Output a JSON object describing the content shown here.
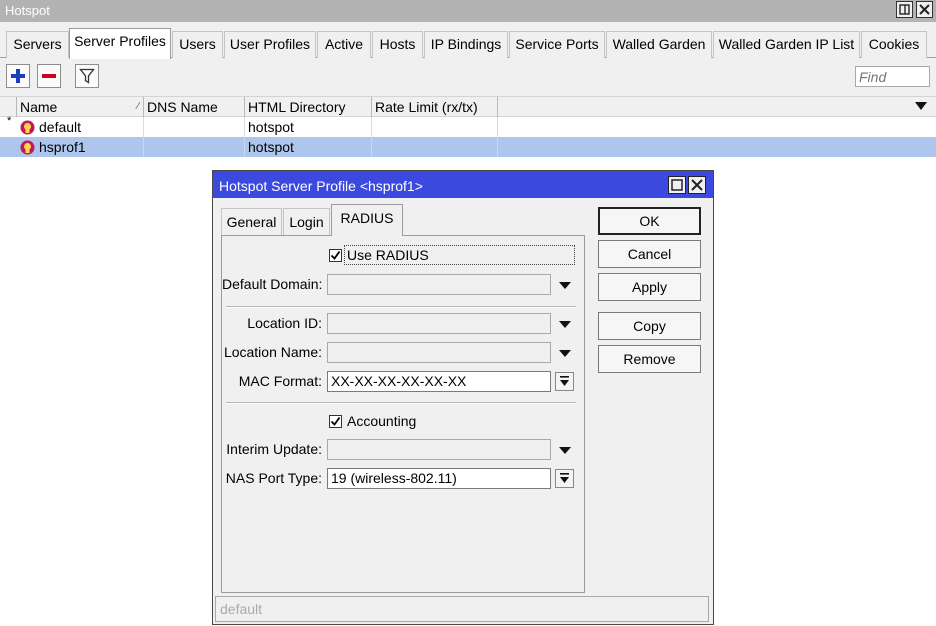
{
  "window": {
    "title": "Hotspot"
  },
  "tabs": [
    {
      "label": "Servers"
    },
    {
      "label": "Server Profiles"
    },
    {
      "label": "Users"
    },
    {
      "label": "User Profiles"
    },
    {
      "label": "Active"
    },
    {
      "label": "Hosts"
    },
    {
      "label": "IP Bindings"
    },
    {
      "label": "Service Ports"
    },
    {
      "label": "Walled Garden"
    },
    {
      "label": "Walled Garden IP List"
    },
    {
      "label": "Cookies"
    }
  ],
  "toolbar": {
    "find_placeholder": "Find"
  },
  "table": {
    "columns": [
      "Name",
      "DNS Name",
      "HTML Directory",
      "Rate Limit (rx/tx)"
    ],
    "rows": [
      {
        "marker": "*",
        "name": "default",
        "dns": "",
        "html_dir": "hotspot",
        "rate": ""
      },
      {
        "marker": "",
        "name": "hsprof1",
        "dns": "",
        "html_dir": "hotspot",
        "rate": ""
      }
    ]
  },
  "colors": {
    "dialog_title": "#3b49df",
    "selected_row": "#aec6ec",
    "add_icon": "#1a3fc4",
    "remove_icon": "#d0021b"
  },
  "dialog": {
    "title": "Hotspot Server Profile <hsprof1>",
    "tabs": [
      {
        "label": "General"
      },
      {
        "label": "Login"
      },
      {
        "label": "RADIUS"
      }
    ],
    "use_radius": {
      "label": "Use RADIUS",
      "checked": true
    },
    "default_domain": {
      "label": "Default Domain:",
      "value": ""
    },
    "location_id": {
      "label": "Location ID:",
      "value": ""
    },
    "location_name": {
      "label": "Location Name:",
      "value": ""
    },
    "mac_format": {
      "label": "MAC Format:",
      "value": "XX-XX-XX-XX-XX-XX"
    },
    "accounting": {
      "label": "Accounting",
      "checked": true
    },
    "interim_update": {
      "label": "Interim Update:",
      "value": ""
    },
    "nas_port_type": {
      "label": "NAS Port Type:",
      "value": "19 (wireless-802.11)"
    },
    "buttons": {
      "ok": "OK",
      "cancel": "Cancel",
      "apply": "Apply",
      "copy": "Copy",
      "remove": "Remove"
    },
    "status": "default"
  }
}
